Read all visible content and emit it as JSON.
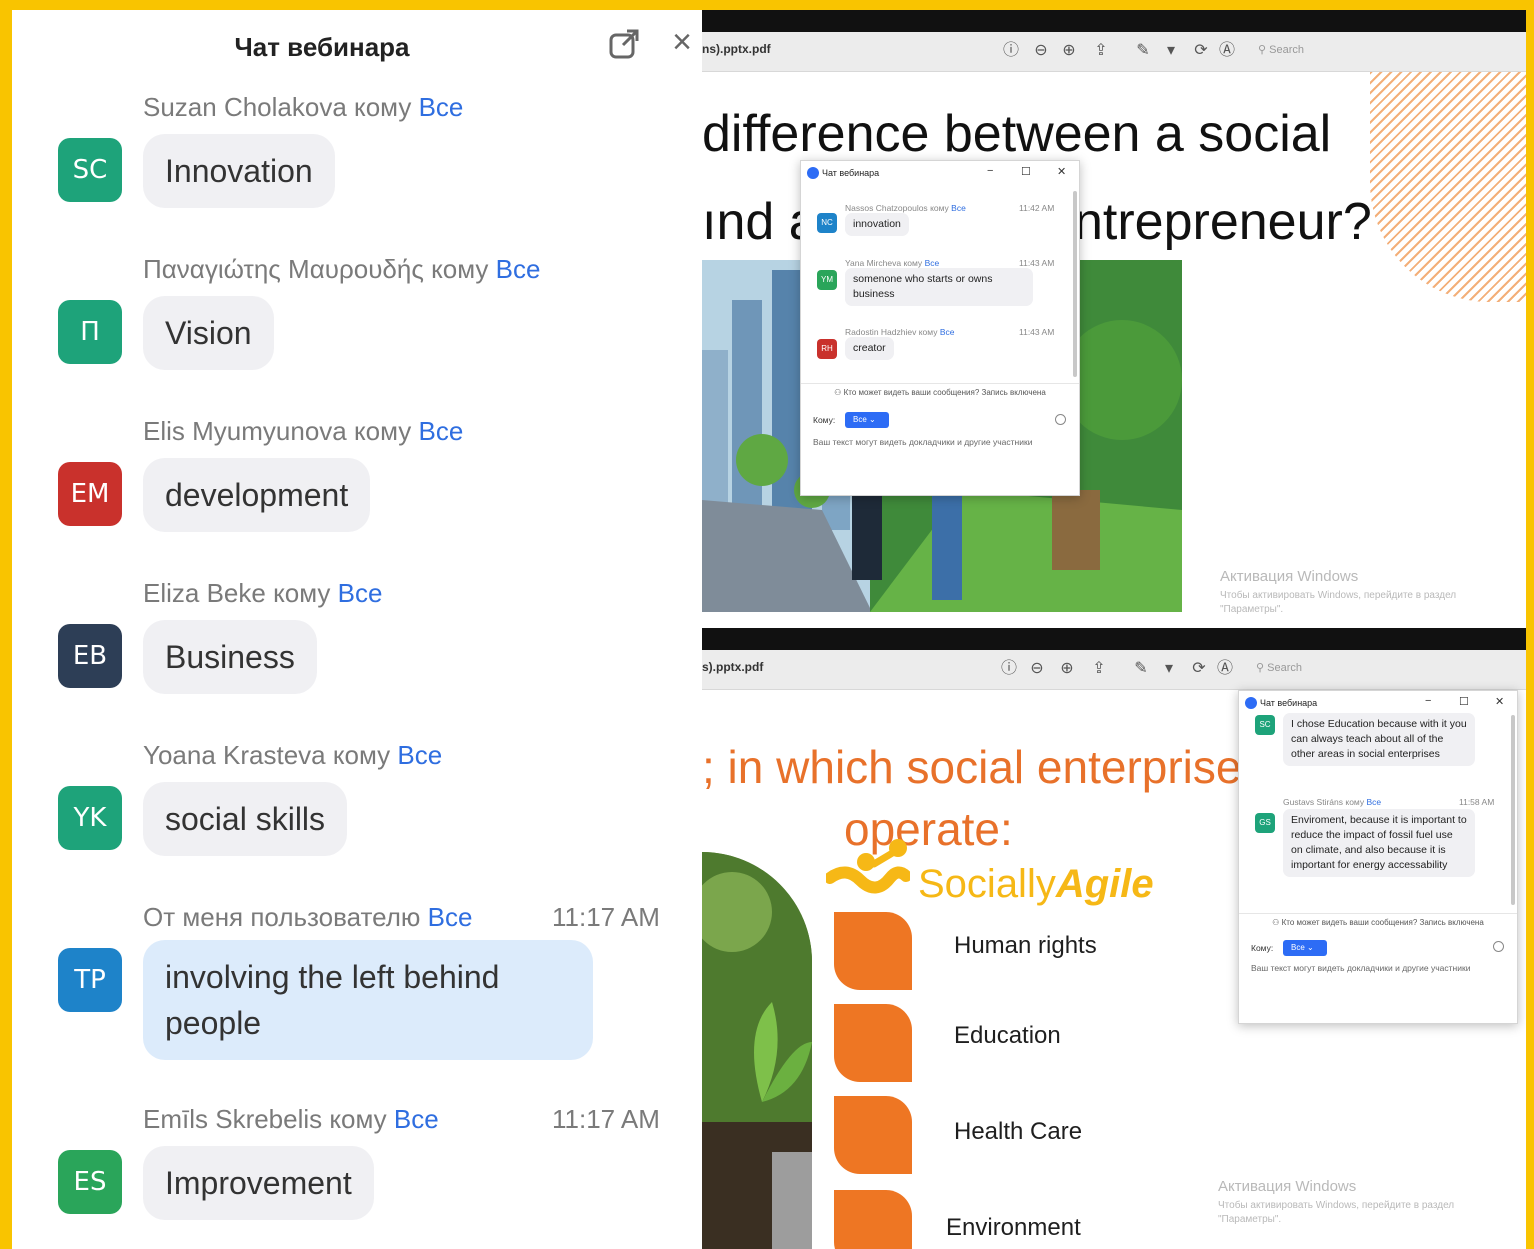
{
  "left_chat": {
    "title": "Чат вебинара",
    "messages": [
      {
        "name": "Suzan Cholakova",
        "to": "кому",
        "all": "Все",
        "time": "",
        "initials": "SC",
        "color": "#1ea37a",
        "text": "Innovation",
        "me": false
      },
      {
        "name": "Παναγιώτης Μαυρουδής",
        "to": "кому",
        "all": "Все",
        "time": "",
        "initials": "П",
        "color": "#1ea37a",
        "text": "Vision",
        "me": false
      },
      {
        "name": "Elis Myumyunova",
        "to": "кому",
        "all": "Все",
        "time": "",
        "initials": "EM",
        "color": "#c9312c",
        "text": "development",
        "me": false
      },
      {
        "name": "Eliza Beke",
        "to": "кому",
        "all": "Все",
        "time": "",
        "initials": "EB",
        "color": "#2d3e56",
        "text": "Business",
        "me": false
      },
      {
        "name": "Yoana Krasteva",
        "to": "кому",
        "all": "Все",
        "time": "",
        "initials": "YK",
        "color": "#1ea37a",
        "text": "social skills",
        "me": false
      },
      {
        "name": "От меня пользователю",
        "to": "",
        "all": "Все",
        "time": "11:17 AM",
        "initials": "TP",
        "color": "#1e83c9",
        "text": "involving the left behind people",
        "me": true
      },
      {
        "name": "Emīls Skrebelis",
        "to": "кому",
        "all": "Все",
        "time": "11:17 AM",
        "initials": "ES",
        "color": "#2aa55a",
        "text": "Improvement",
        "me": false
      }
    ]
  },
  "top_slide": {
    "filename": "ns).pptx.pdf",
    "search_placeholder": "Search",
    "title_line1": "difference between a social",
    "title_line2a": "ınd a",
    "title_line2b": "ntrepreneur?",
    "windows_activation": {
      "title": "Активация Windows",
      "line1": "Чтобы активировать Windows, перейдите в раздел",
      "line2": "\"Параметры\"."
    },
    "chat": {
      "title": "Чат вебинара",
      "messages": [
        {
          "name": "Nassos Chatzopoulos",
          "to": "кому",
          "all": "Все",
          "time": "11:42 AM",
          "initials": "NC",
          "color": "#1e83c9",
          "text": "innovation"
        },
        {
          "name": "Yana Mircheva",
          "to": "кому",
          "all": "Все",
          "time": "11:43 AM",
          "initials": "YM",
          "color": "#2aa55a",
          "text": "somenone who starts or owns business"
        },
        {
          "name": "Radostin Hadzhiev",
          "to": "кому",
          "all": "Все",
          "time": "11:43 AM",
          "initials": "RH",
          "color": "#c9312c",
          "text": "creator"
        }
      ],
      "visibility_note": "Кто может видеть ваши сообщения? Запись включена",
      "to_label": "Кому:",
      "to_value": "Все",
      "hint": "Ваш текст могут видеть докладчики и другие участники"
    }
  },
  "bottom_slide": {
    "filename": "s).pptx.pdf",
    "search_placeholder": "Search",
    "title_line1": "; in which social enterprise",
    "title_line2": "operate:",
    "logo": {
      "part1": "Socially",
      "part2": "Agile"
    },
    "items": [
      "Human rights",
      "Education",
      "Health Care",
      "Environment"
    ],
    "windows_activation": {
      "title": "Активация Windows",
      "line1": "Чтобы активировать Windows, перейдите в раздел",
      "line2": "\"Параметры\"."
    },
    "chat": {
      "title": "Чат вебинара",
      "messages": [
        {
          "name": "",
          "to": "",
          "all": "",
          "time": "",
          "initials": "SC",
          "color": "#1ea37a",
          "text": "I chose Education because with it you can always teach about all of the other areas in social enterprises"
        },
        {
          "name": "Gustavs Stiráns",
          "to": "кому",
          "all": "Все",
          "time": "11:58 AM",
          "initials": "GS",
          "color": "#1ea37a",
          "text": "Enviroment, because it is important to reduce the impact of fossil fuel use on climate, and also because it is important for energy accessability"
        }
      ],
      "visibility_note": "Кто может видеть ваши сообщения? Запись включена",
      "to_label": "Кому:",
      "to_value": "Все",
      "hint": "Ваш текст могут видеть докладчики и другие участники"
    }
  }
}
